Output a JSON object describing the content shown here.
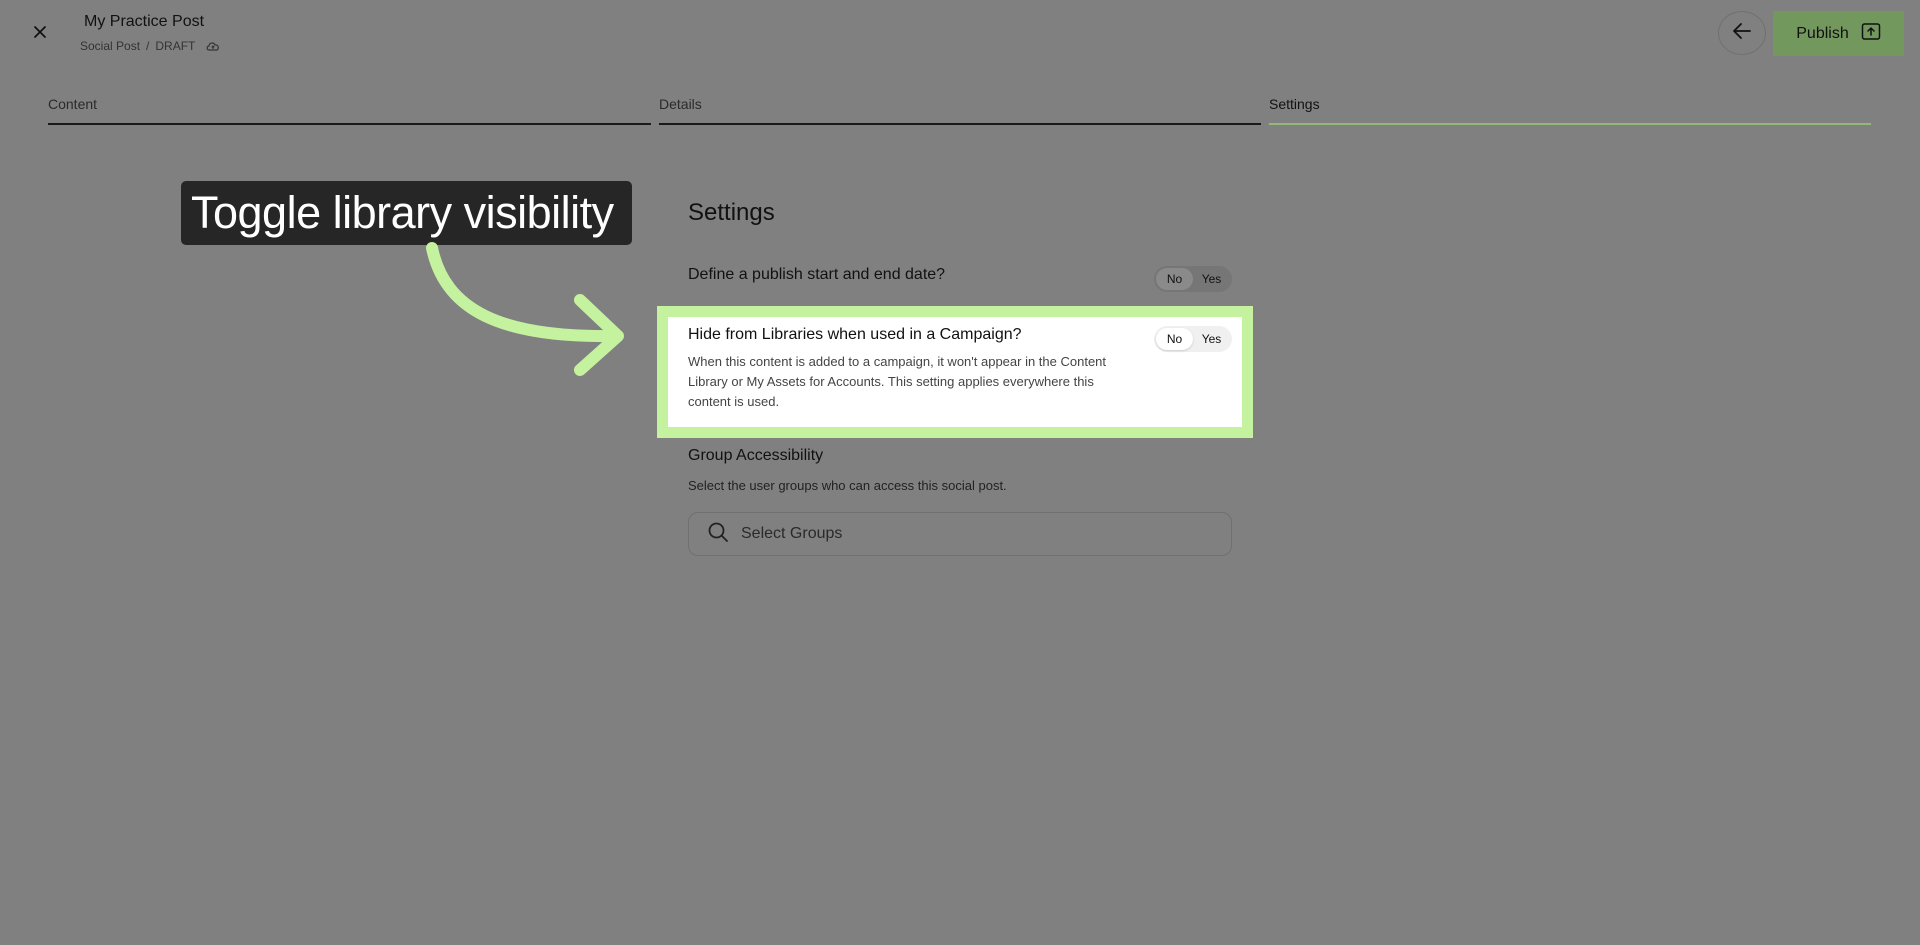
{
  "header": {
    "post_title": "My Practice Post",
    "post_type": "Social Post",
    "separator": "/",
    "status": "DRAFT",
    "publish_label": "Publish"
  },
  "tabs": [
    {
      "label": "Content"
    },
    {
      "label": "Details"
    },
    {
      "label": "Settings"
    }
  ],
  "callout": {
    "text": "Toggle library visibility",
    "accent_color": "#c5f29e"
  },
  "settings": {
    "heading": "Settings",
    "publish_dates": {
      "label": "Define a publish start and end date?",
      "no_label": "No",
      "yes_label": "Yes"
    },
    "hide_from_libraries": {
      "label": "Hide from Libraries when used in a Campaign?",
      "description": "When this content is added to a campaign, it won't appear in the Content Library or My Assets for Accounts. This setting applies everywhere this content is used.",
      "no_label": "No",
      "yes_label": "Yes"
    },
    "group_accessibility": {
      "heading": "Group Accessibility",
      "description": "Select the user groups who can access this social post.",
      "placeholder": "Select Groups"
    }
  }
}
